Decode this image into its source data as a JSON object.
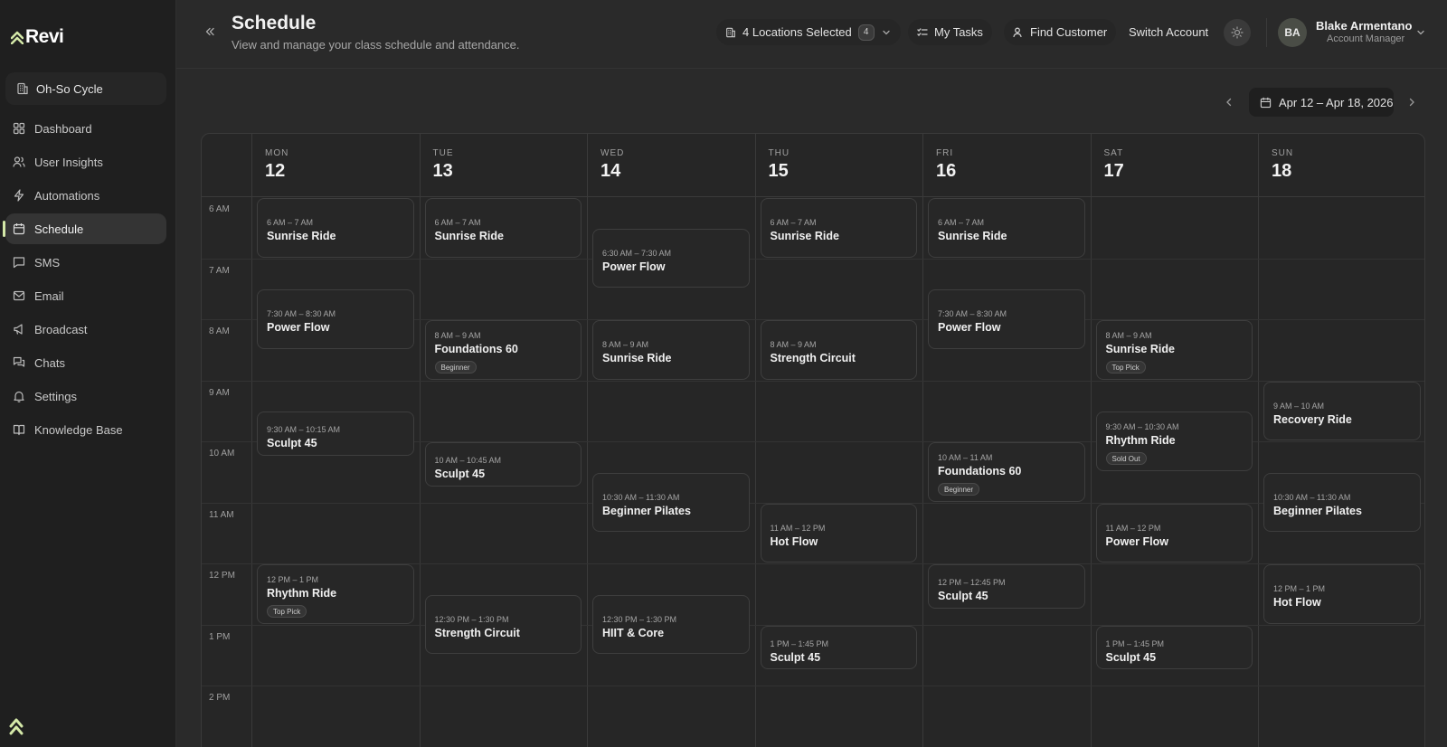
{
  "brand": {
    "name": "Revi",
    "accent": "#d4e8a8"
  },
  "sidebar": {
    "org": {
      "label": "Oh-So Cycle",
      "icon": "building-icon"
    },
    "items": [
      {
        "label": "Dashboard",
        "icon": "grid-icon",
        "active": false
      },
      {
        "label": "User Insights",
        "icon": "users-icon",
        "active": false
      },
      {
        "label": "Automations",
        "icon": "bolt-icon",
        "active": false
      },
      {
        "label": "Schedule",
        "icon": "calendar-icon",
        "active": true
      },
      {
        "label": "SMS",
        "icon": "message-icon",
        "active": false
      },
      {
        "label": "Email",
        "icon": "mail-icon",
        "active": false
      },
      {
        "label": "Broadcast",
        "icon": "megaphone-icon",
        "active": false
      },
      {
        "label": "Chats",
        "icon": "chats-icon",
        "active": false
      },
      {
        "label": "Settings",
        "icon": "bell-icon",
        "active": false
      },
      {
        "label": "Knowledge Base",
        "icon": "book-icon",
        "active": false
      }
    ]
  },
  "header": {
    "title": "Schedule",
    "subtitle": "View and manage your class schedule and attendance.",
    "locations": {
      "label": "4 Locations Selected",
      "count": "4"
    },
    "my_tasks": "My Tasks",
    "find_customer": "Find Customer",
    "switch_account": "Switch Account",
    "user": {
      "initials": "BA",
      "name": "Blake Armentano",
      "role": "Account Manager"
    }
  },
  "date_range": "Apr 12 – Apr 18, 2026",
  "calendar": {
    "days": [
      {
        "dow": "MON",
        "num": "12"
      },
      {
        "dow": "TUE",
        "num": "13"
      },
      {
        "dow": "WED",
        "num": "14"
      },
      {
        "dow": "THU",
        "num": "15"
      },
      {
        "dow": "FRI",
        "num": "16"
      },
      {
        "dow": "SAT",
        "num": "17"
      },
      {
        "dow": "SUN",
        "num": "18"
      }
    ],
    "times": [
      "6 AM",
      "7 AM",
      "8 AM",
      "9 AM",
      "10 AM",
      "11 AM",
      "12 PM",
      "1 PM",
      "2 PM"
    ],
    "events": [
      {
        "day": 0,
        "start": 6,
        "end": 7,
        "time": "6 AM – 7 AM",
        "title": "Sunrise Ride"
      },
      {
        "day": 0,
        "start": 7.5,
        "end": 8.5,
        "time": "7:30 AM – 8:30 AM",
        "title": "Power Flow"
      },
      {
        "day": 0,
        "start": 9.5,
        "end": 10.25,
        "time": "9:30 AM – 10:15 AM",
        "title": "Sculpt 45"
      },
      {
        "day": 0,
        "start": 12,
        "end": 13,
        "time": "12 PM – 1 PM",
        "title": "Rhythm Ride",
        "tag": "Top Pick"
      },
      {
        "day": 1,
        "start": 6,
        "end": 7,
        "time": "6 AM – 7 AM",
        "title": "Sunrise Ride"
      },
      {
        "day": 1,
        "start": 8,
        "end": 9,
        "time": "8 AM – 9 AM",
        "title": "Foundations 60",
        "tag": "Beginner"
      },
      {
        "day": 1,
        "start": 10,
        "end": 10.75,
        "time": "10 AM – 10:45 AM",
        "title": "Sculpt 45"
      },
      {
        "day": 1,
        "start": 12.5,
        "end": 13.5,
        "time": "12:30 PM – 1:30 PM",
        "title": "Strength Circuit"
      },
      {
        "day": 2,
        "start": 6.5,
        "end": 7.5,
        "time": "6:30 AM – 7:30 AM",
        "title": "Power Flow"
      },
      {
        "day": 2,
        "start": 8,
        "end": 9,
        "time": "8 AM – 9 AM",
        "title": "Sunrise Ride"
      },
      {
        "day": 2,
        "start": 10.5,
        "end": 11.5,
        "time": "10:30 AM – 11:30 AM",
        "title": "Beginner Pilates"
      },
      {
        "day": 2,
        "start": 12.5,
        "end": 13.5,
        "time": "12:30 PM – 1:30 PM",
        "title": "HIIT & Core"
      },
      {
        "day": 3,
        "start": 6,
        "end": 7,
        "time": "6 AM – 7 AM",
        "title": "Sunrise Ride"
      },
      {
        "day": 3,
        "start": 8,
        "end": 9,
        "time": "8 AM – 9 AM",
        "title": "Strength Circuit"
      },
      {
        "day": 3,
        "start": 11,
        "end": 12,
        "time": "11 AM – 12 PM",
        "title": "Hot Flow"
      },
      {
        "day": 3,
        "start": 13,
        "end": 13.75,
        "time": "1 PM – 1:45 PM",
        "title": "Sculpt 45"
      },
      {
        "day": 4,
        "start": 6,
        "end": 7,
        "time": "6 AM – 7 AM",
        "title": "Sunrise Ride"
      },
      {
        "day": 4,
        "start": 7.5,
        "end": 8.5,
        "time": "7:30 AM – 8:30 AM",
        "title": "Power Flow"
      },
      {
        "day": 4,
        "start": 10,
        "end": 11,
        "time": "10 AM – 11 AM",
        "title": "Foundations 60",
        "tag": "Beginner"
      },
      {
        "day": 4,
        "start": 12,
        "end": 12.75,
        "time": "12 PM – 12:45 PM",
        "title": "Sculpt 45"
      },
      {
        "day": 5,
        "start": 8,
        "end": 9,
        "time": "8 AM – 9 AM",
        "title": "Sunrise Ride",
        "tag": "Top Pick"
      },
      {
        "day": 5,
        "start": 9.5,
        "end": 10.5,
        "time": "9:30 AM – 10:30 AM",
        "title": "Rhythm Ride",
        "tag": "Sold Out"
      },
      {
        "day": 5,
        "start": 11,
        "end": 12,
        "time": "11 AM – 12 PM",
        "title": "Power Flow"
      },
      {
        "day": 5,
        "start": 13,
        "end": 13.75,
        "time": "1 PM – 1:45 PM",
        "title": "Sculpt 45"
      },
      {
        "day": 6,
        "start": 9,
        "end": 10,
        "time": "9 AM – 10 AM",
        "title": "Recovery Ride"
      },
      {
        "day": 6,
        "start": 10.5,
        "end": 11.5,
        "time": "10:30 AM – 11:30 AM",
        "title": "Beginner Pilates"
      },
      {
        "day": 6,
        "start": 12,
        "end": 13,
        "time": "12 PM – 1 PM",
        "title": "Hot Flow"
      }
    ]
  }
}
